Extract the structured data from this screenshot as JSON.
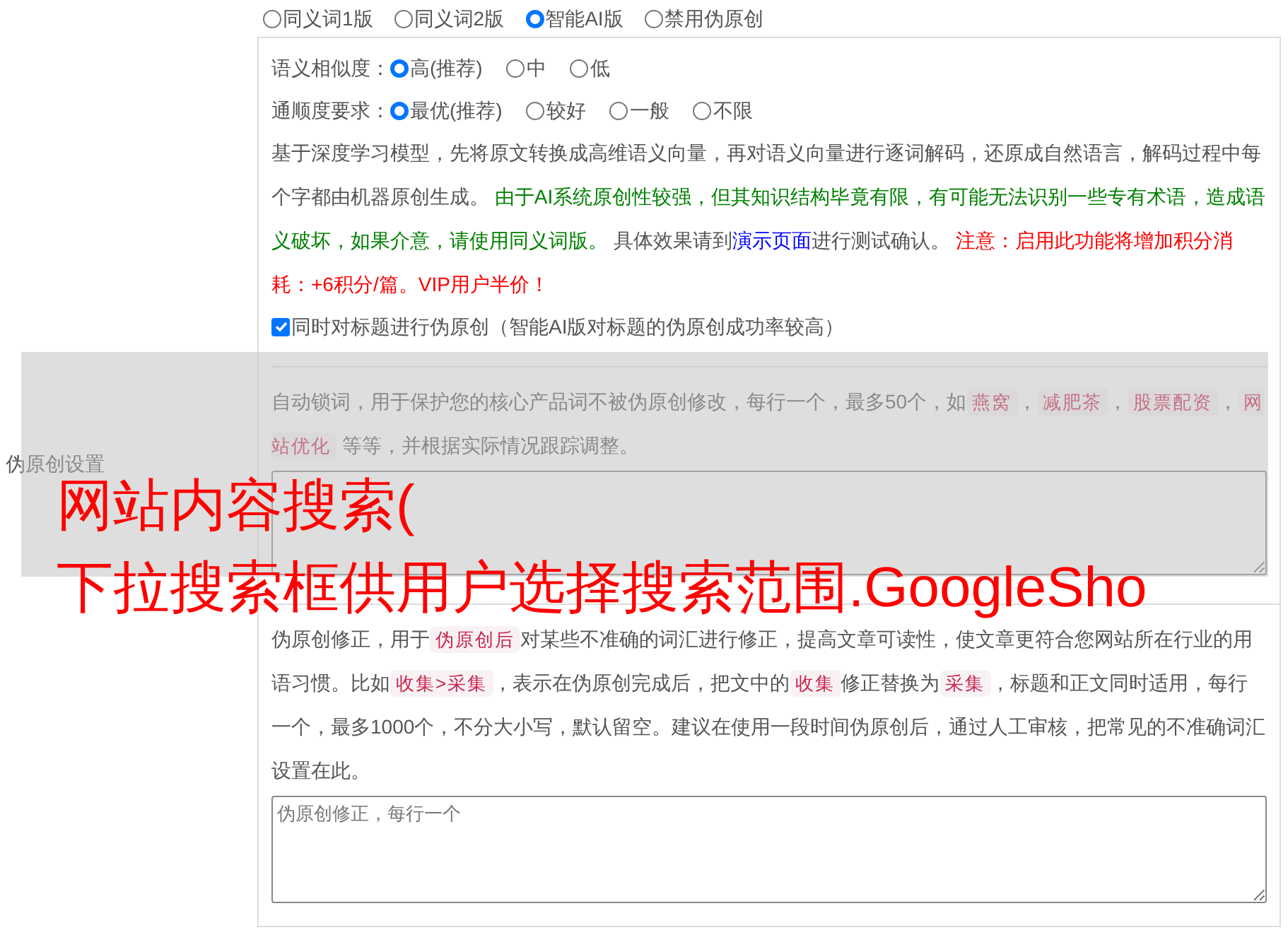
{
  "sidebar_label": "伪原创设置",
  "mode_options": [
    {
      "label": "同义词1版",
      "selected": false
    },
    {
      "label": "同义词2版",
      "selected": false
    },
    {
      "label": "智能AI版",
      "selected": true
    },
    {
      "label": "禁用伪原创",
      "selected": false
    }
  ],
  "ai_settings": {
    "option_groups": [
      {
        "label": "语义相似度：",
        "options": [
          {
            "label": "高(推荐)",
            "selected": true
          },
          {
            "label": "中",
            "selected": false
          },
          {
            "label": "低",
            "selected": false
          }
        ]
      },
      {
        "label": "通顺度要求：",
        "options": [
          {
            "label": "最优(推荐)",
            "selected": true
          },
          {
            "label": "较好",
            "selected": false
          },
          {
            "label": "一般",
            "selected": false
          },
          {
            "label": "不限",
            "selected": false
          }
        ]
      }
    ],
    "description": [
      {
        "kind": "plain",
        "text": "基于深度学习模型，先将原文转换成高维语义向量，再对语义向量进行逐词解码，还原成自然语言，解码过程中每个字都由机器原创生成。 "
      },
      {
        "kind": "note",
        "text": "由于AI系统原创性较强，但其知识结构毕竟有限，有可能无法识别一些专有术语，造成语义破坏，如果介意，请使用同义词版。"
      },
      {
        "kind": "plain",
        "text": " 具体效果请到"
      },
      {
        "kind": "link",
        "text": "演示页面"
      },
      {
        "kind": "plain",
        "text": "进行测试确认。 "
      },
      {
        "kind": "warning",
        "text": "注意：启用此功能将增加积分消耗：+6积分/篇。VIP用户半价！"
      }
    ],
    "title_checkbox": {
      "label": "同时对标题进行伪原创（智能AI版对标题的伪原创成功率较高）",
      "checked": true
    }
  },
  "lock_words": {
    "description": [
      {
        "kind": "plain",
        "text": "自动锁词，用于保护您的核心产品词不被伪原创修改，每行一个，最多50个，如"
      },
      {
        "kind": "code",
        "text": "燕窝"
      },
      {
        "kind": "plain",
        "text": "，"
      },
      {
        "kind": "code",
        "text": "减肥茶"
      },
      {
        "kind": "plain",
        "text": "，"
      },
      {
        "kind": "code",
        "text": "股票配资"
      },
      {
        "kind": "plain",
        "text": "，"
      },
      {
        "kind": "code",
        "text": "网站优化"
      },
      {
        "kind": "plain",
        "text": " 等等，并根据实际情况跟踪调整。"
      }
    ]
  },
  "correction": {
    "description": [
      {
        "kind": "plain",
        "text": "伪原创修正，用于"
      },
      {
        "kind": "code",
        "text": "伪原创后"
      },
      {
        "kind": "plain",
        "text": "对某些不准确的词汇进行修正，提高文章可读性，使文章更符合您网站所在行业的用语习惯。比如"
      },
      {
        "kind": "code",
        "text": "收集>采集"
      },
      {
        "kind": "plain",
        "text": "，表示在伪原创完成后，把文中的"
      },
      {
        "kind": "code",
        "text": "收集"
      },
      {
        "kind": "plain",
        "text": "修正替换为"
      },
      {
        "kind": "code",
        "text": "采集"
      },
      {
        "kind": "plain",
        "text": "，标题和正文同时适用，每行一个，最多1000个，不分大小写，默认留空。建议在使用一段时间伪原创后，通过人工审核，把常见的不准确词汇设置在此。"
      }
    ],
    "field": {
      "placeholder": "伪原创修正，每行一个"
    }
  },
  "overlay": {
    "lines": [
      "网站内容搜索(",
      "下拉搜索框供用户选择搜索范围.GoogleSho"
    ]
  }
}
